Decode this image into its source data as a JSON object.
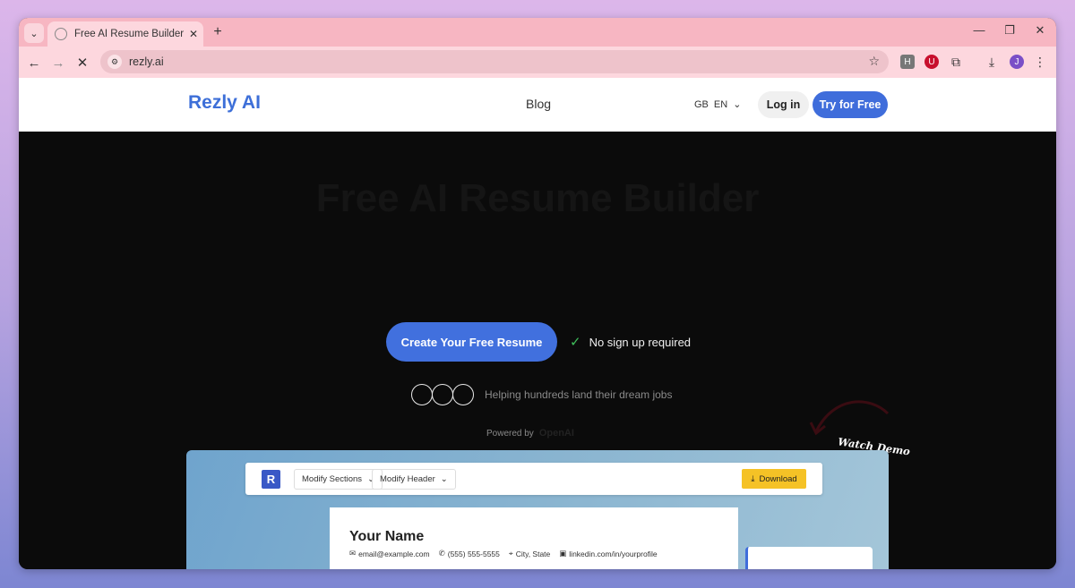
{
  "browser": {
    "tab_title": "Free AI Resume Builder - Rezly.ai",
    "tab_close": "✕",
    "new_tab": "+",
    "url": "rezly.ai",
    "controls": {
      "minimize": "—",
      "restore": "❐",
      "close": "✕"
    },
    "extensions": [
      "H",
      "U"
    ],
    "profile_initial": "J"
  },
  "header": {
    "brand": "Rezly AI",
    "nav_blog": "Blog",
    "lang_region": "GB",
    "lang_code": "EN",
    "login_label": "Log in",
    "try_label": "Try for Free"
  },
  "hero": {
    "title": "Free AI Resume Builder",
    "subtitle": "",
    "cta_label": "Create Your Free Resume",
    "no_signup": "No sign up required",
    "helping": "Helping hundreds land their dream jobs",
    "powered_by": "Powered by",
    "powered_brand": "OpenAI",
    "watch_demo": "Watch Demo"
  },
  "demo": {
    "logo_letter": "R",
    "modify_sections": "Modify Sections",
    "modify_header": "Modify Header",
    "download": "Download",
    "resume_name": "Your Name",
    "email": "email@example.com",
    "phone": "(555) 555-5555",
    "location": "City, State",
    "linkedin": "linkedin.com/in/yourprofile"
  }
}
